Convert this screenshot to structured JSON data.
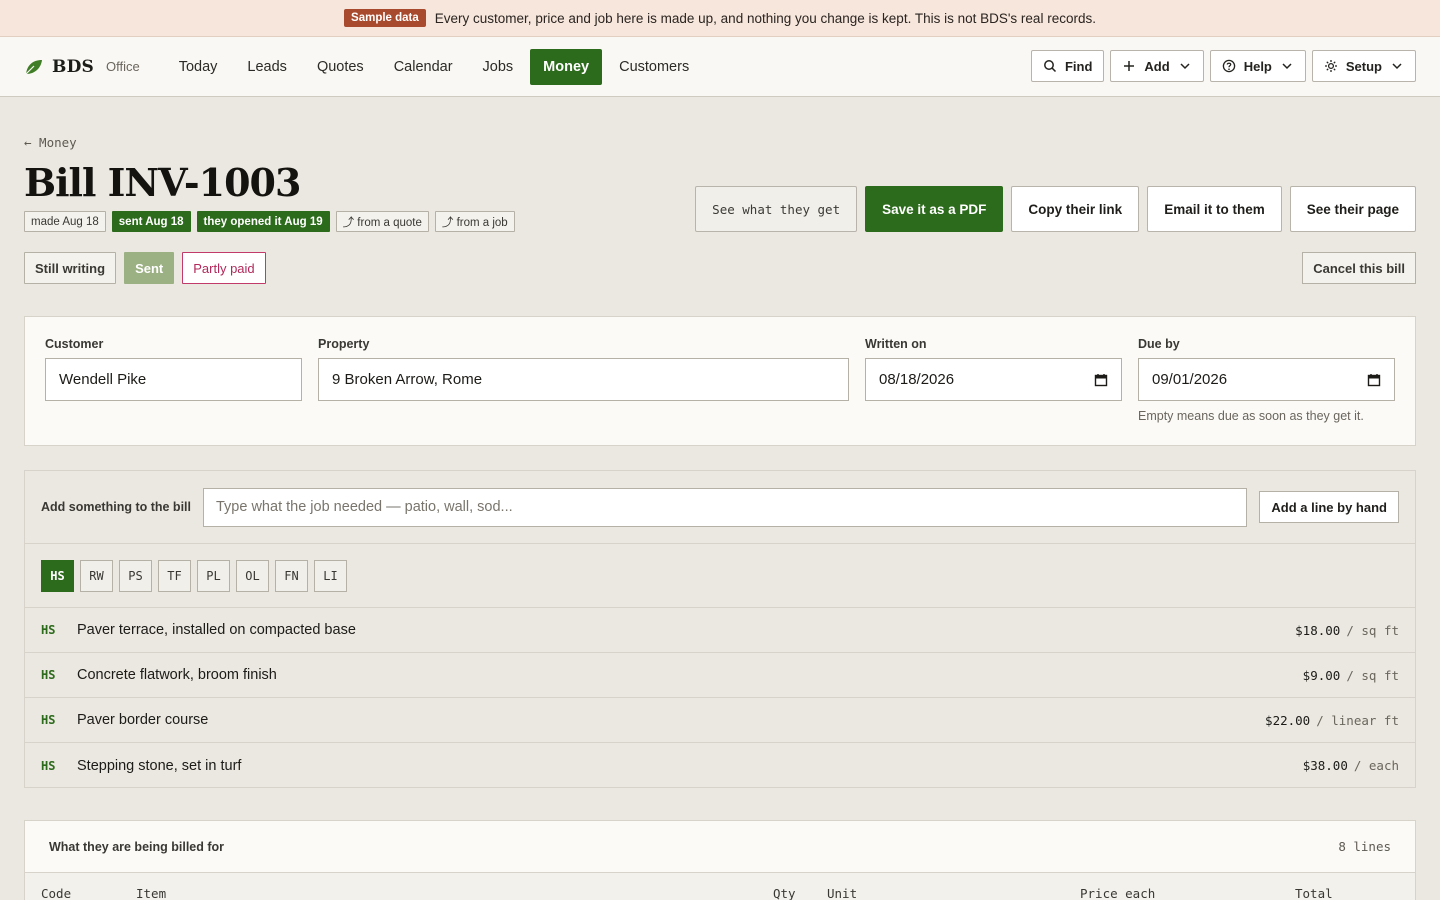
{
  "banner": {
    "badge": "Sample data",
    "text": "Every customer, price and job here is made up, and nothing you change is kept. This is not BDS's real records."
  },
  "nav": {
    "brand": "BDS",
    "brand_sub": "Office",
    "links": [
      "Today",
      "Leads",
      "Quotes",
      "Calendar",
      "Jobs",
      "Money",
      "Customers"
    ],
    "active": "Money",
    "find": "Find",
    "add": "Add",
    "help": "Help",
    "setup": "Setup"
  },
  "page": {
    "back": "← Money",
    "title": "Bill INV-1003",
    "tags": [
      "made Aug 18",
      "sent Aug 18",
      "they opened it Aug 19",
      "⤴ from a quote",
      "⤴ from a job"
    ],
    "actions": {
      "preview": "See what they get",
      "pdf": "Save it as a PDF",
      "copy": "Copy their link",
      "email": "Email it to them",
      "page": "See their page"
    },
    "status": [
      "Still writing",
      "Sent",
      "Partly paid"
    ],
    "cancel": "Cancel this bill"
  },
  "form": {
    "customer_label": "Customer",
    "customer": "Wendell Pike",
    "property_label": "Property",
    "property": "9 Broken Arrow, Rome",
    "written_label": "Written on",
    "written": "08/18/2026",
    "due_label": "Due by",
    "due": "09/01/2026",
    "due_hint": "Empty means due as soon as they get it."
  },
  "catalog": {
    "label": "Add something to the bill",
    "placeholder": "Type what the job needed — patio, wall, sod...",
    "by_hand": "Add a line by hand",
    "chips": [
      "HS",
      "RW",
      "PS",
      "TF",
      "PL",
      "OL",
      "FN",
      "LI"
    ],
    "active_chip": "HS",
    "items": [
      {
        "code": "HS",
        "name": "Paver terrace, installed on compacted base",
        "price": "$18.00",
        "unit": "/ sq ft"
      },
      {
        "code": "HS",
        "name": "Concrete flatwork, broom finish",
        "price": "$9.00",
        "unit": "/ sq ft"
      },
      {
        "code": "HS",
        "name": "Paver border course",
        "price": "$22.00",
        "unit": "/ linear ft"
      },
      {
        "code": "HS",
        "name": "Stepping stone, set in turf",
        "price": "$38.00",
        "unit": "/ each"
      }
    ]
  },
  "lines": {
    "title": "What they are being billed for",
    "count": "8 lines",
    "columns": [
      "Code",
      "Item",
      "Qty",
      "Unit",
      "Price each",
      "Total"
    ]
  },
  "colors": {
    "accent": "#2c6a1c",
    "sample_badge": "#a84a2e",
    "partly_paid": "#c23a6a"
  }
}
